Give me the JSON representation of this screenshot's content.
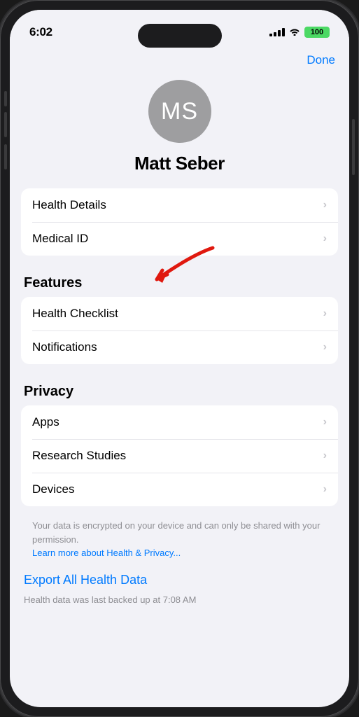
{
  "statusBar": {
    "time": "6:02",
    "battery": "100"
  },
  "header": {
    "doneLabel": "Done"
  },
  "profile": {
    "initials": "MS",
    "name": "Matt Seber"
  },
  "profileItems": [
    {
      "label": "Health Details"
    },
    {
      "label": "Medical ID"
    }
  ],
  "sections": [
    {
      "title": "Features",
      "items": [
        {
          "label": "Health Checklist"
        },
        {
          "label": "Notifications"
        }
      ]
    },
    {
      "title": "Privacy",
      "items": [
        {
          "label": "Apps"
        },
        {
          "label": "Research Studies"
        },
        {
          "label": "Devices"
        }
      ]
    }
  ],
  "privacyNote": "Your data is encrypted on your device and can only be shared with your permission.",
  "privacyLink": "Learn more about Health & Privacy...",
  "exportLabel": "Export All Health Data",
  "lastBacked": "Health data was last backed up at 7:08 AM"
}
